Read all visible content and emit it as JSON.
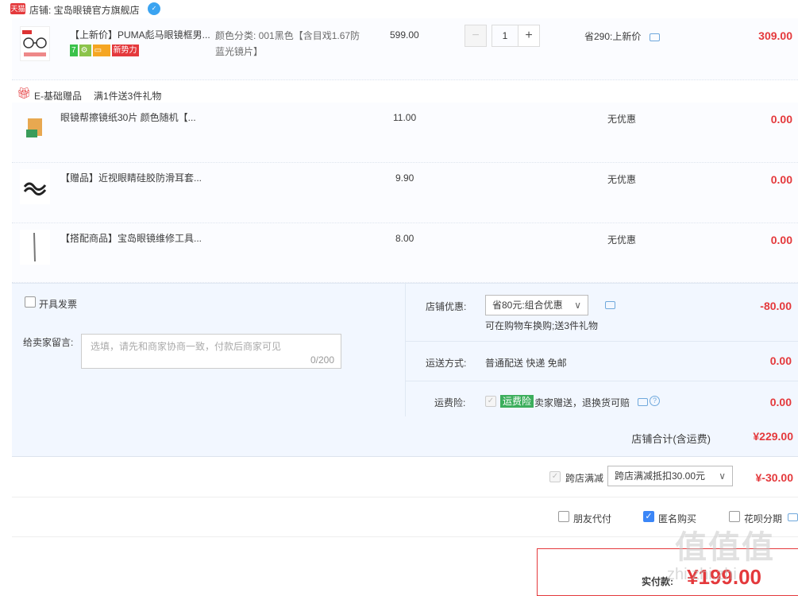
{
  "shop": {
    "tmall_badge": "天猫",
    "label": "店铺: 宝岛眼镜官方旗舰店"
  },
  "main_item": {
    "title": "【上新价】PUMA彪马眼镜框男...",
    "sku": "颜色分类: 001黑色【含目戏1.67防蓝光镜片】",
    "unit_price": "599.00",
    "quantity": "1",
    "promo": "省290:上新价",
    "total": "309.00",
    "tags": [
      "7",
      "新势力"
    ]
  },
  "gift_header": {
    "label": "E-基础赠品",
    "rule": "满1件送3件礼物"
  },
  "gifts": [
    {
      "title": "眼镜帮擦镜纸30片 颜色随机【...",
      "price": "11.00",
      "promo": "无优惠",
      "total": "0.00"
    },
    {
      "title": "【赠品】近视眼睛硅胶防滑耳套...",
      "price": "9.90",
      "promo": "无优惠",
      "total": "0.00"
    },
    {
      "title": "【搭配商品】宝岛眼镜维修工具...",
      "price": "8.00",
      "promo": "无优惠",
      "total": "0.00"
    }
  ],
  "invoice": {
    "label": "开具发票"
  },
  "message": {
    "label": "给卖家留言:",
    "placeholder": "选填，请先和商家协商一致，付款后商家可见",
    "counter": "0/200"
  },
  "shop_discount": {
    "label": "店铺优惠:",
    "value": "省80元:组合优惠",
    "note": "可在购物车换购;送3件礼物",
    "amount": "-80.00"
  },
  "shipping": {
    "label": "运送方式:",
    "value": "普通配送 快递 免邮",
    "amount": "0.00"
  },
  "insurance": {
    "label": "运费险:",
    "badge": "运费险",
    "text": "卖家赠送，退换货可赔",
    "amount": "0.00"
  },
  "shop_total": {
    "label": "店铺合计(含运费)",
    "amount": "¥229.00"
  },
  "cross_store": {
    "label": "跨店满减",
    "value": "跨店满减抵扣30.00元",
    "amount": "¥-30.00"
  },
  "pay_options": {
    "friend": "朋友代付",
    "anonymous": "匿名购买",
    "huabei": "花呗分期"
  },
  "pay": {
    "label": "实付款:",
    "amount": "¥199.00"
  },
  "watermark": {
    "big": "值值值",
    "small": "zhi.zhi.zhi"
  },
  "colors": {
    "accent": "#e4393c",
    "panel": "#f2f7ff",
    "link": "#3b86f7"
  }
}
